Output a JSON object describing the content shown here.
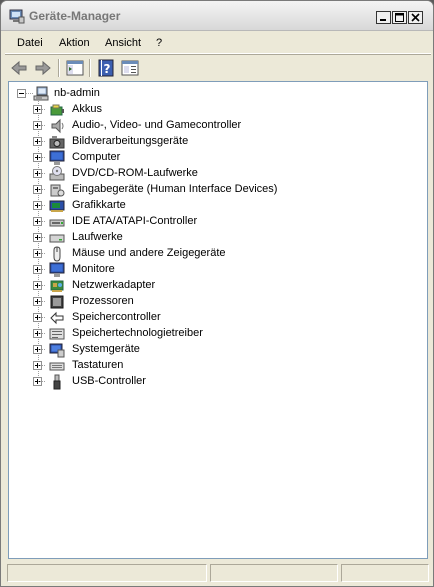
{
  "window": {
    "title": "Geräte-Manager",
    "icon": "device-manager-icon"
  },
  "titlebar_buttons": [
    {
      "name": "minimize-button",
      "icon": "minimize-icon",
      "glyph": "_"
    },
    {
      "name": "maximize-button",
      "icon": "maximize-icon",
      "glyph": "□"
    },
    {
      "name": "close-button",
      "icon": "close-icon",
      "glyph": "×"
    }
  ],
  "menu": {
    "items": [
      "Datei",
      "Aktion",
      "Ansicht",
      "?"
    ]
  },
  "toolbar": {
    "tools": [
      {
        "name": "back-button",
        "icon": "back-arrow-icon"
      },
      {
        "name": "forward-button",
        "icon": "forward-arrow-icon"
      },
      {
        "name": "show-hide-console-tree-button",
        "icon": "console-tree-icon"
      },
      {
        "name": "help-button",
        "icon": "help-icon"
      },
      {
        "name": "properties-button",
        "icon": "properties-icon"
      }
    ]
  },
  "tree": {
    "root": {
      "label": "nb-admin",
      "icon": "computer-icon",
      "expanded": true
    },
    "categories": [
      {
        "label": "Akkus",
        "icon": "battery-icon"
      },
      {
        "label": "Audio-, Video- und Gamecontroller",
        "icon": "speaker-icon"
      },
      {
        "label": "Bildverarbeitungsgeräte",
        "icon": "camera-icon"
      },
      {
        "label": "Computer",
        "icon": "monitor-icon"
      },
      {
        "label": "DVD/CD-ROM-Laufwerke",
        "icon": "cd-drive-icon"
      },
      {
        "label": "Eingabegeräte (Human Interface Devices)",
        "icon": "hid-icon"
      },
      {
        "label": "Grafikkarte",
        "icon": "display-adapter-icon"
      },
      {
        "label": "IDE ATA/ATAPI-Controller",
        "icon": "ide-controller-icon"
      },
      {
        "label": "Laufwerke",
        "icon": "disk-drive-icon"
      },
      {
        "label": "Mäuse und andere Zeigegeräte",
        "icon": "mouse-icon"
      },
      {
        "label": "Monitore",
        "icon": "monitor-icon"
      },
      {
        "label": "Netzwerkadapter",
        "icon": "network-adapter-icon"
      },
      {
        "label": "Prozessoren",
        "icon": "processor-icon"
      },
      {
        "label": "Speichercontroller",
        "icon": "storage-controller-icon"
      },
      {
        "label": "Speichertechnologietreiber",
        "icon": "storage-driver-icon"
      },
      {
        "label": "Systemgeräte",
        "icon": "system-devices-icon"
      },
      {
        "label": "Tastaturen",
        "icon": "keyboard-icon"
      },
      {
        "label": "USB-Controller",
        "icon": "usb-icon"
      }
    ]
  },
  "statusbar": {
    "panels": [
      "",
      "",
      ""
    ]
  }
}
